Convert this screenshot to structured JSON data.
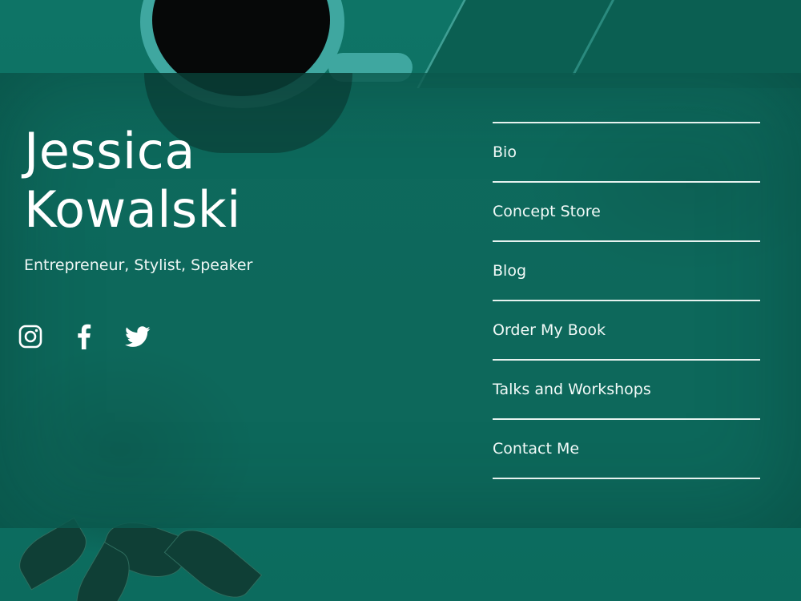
{
  "profile": {
    "first_name": "Jessica",
    "last_name": "Kowalski",
    "tagline": "Entrepreneur, Stylist, Speaker"
  },
  "socials": [
    {
      "icon": "instagram-icon"
    },
    {
      "icon": "facebook-icon"
    },
    {
      "icon": "twitter-icon"
    }
  ],
  "nav": {
    "items": [
      {
        "label": "Bio"
      },
      {
        "label": "Concept Store"
      },
      {
        "label": "Blog"
      },
      {
        "label": "Order My Book"
      },
      {
        "label": "Talks and Workshops"
      },
      {
        "label": "Contact Me"
      }
    ]
  },
  "colors": {
    "background": "#0d7365",
    "panel": "#0e665a",
    "text": "#ffffff",
    "divider": "#e6f2ef"
  }
}
